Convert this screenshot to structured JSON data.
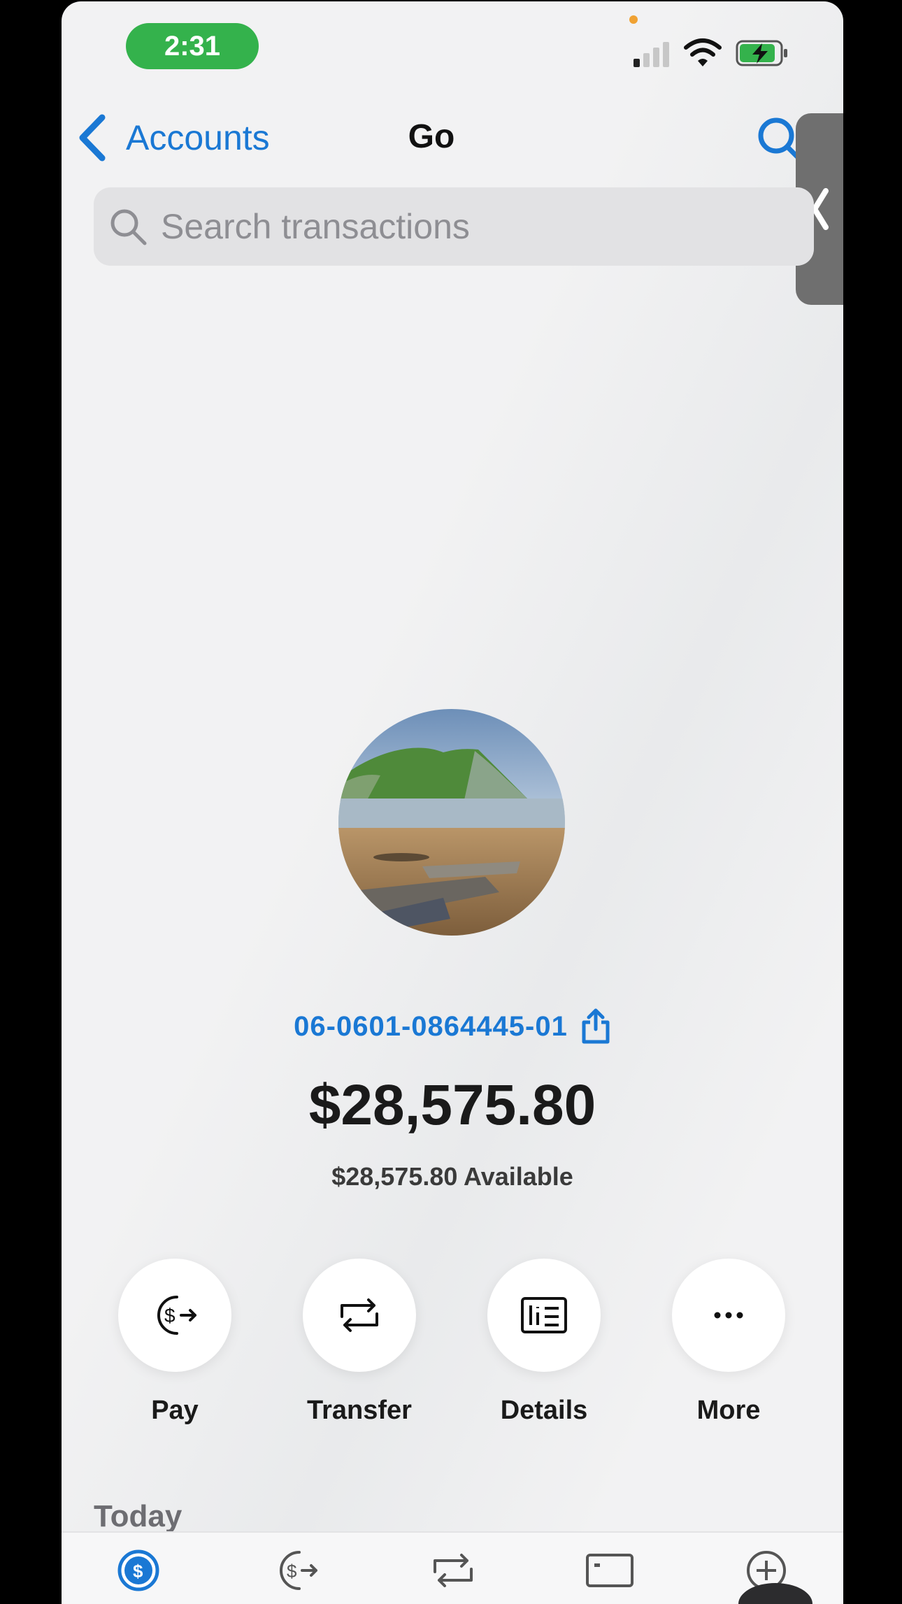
{
  "status_bar": {
    "time": "2:31"
  },
  "nav": {
    "back_label": "Accounts",
    "title": "Go"
  },
  "search": {
    "placeholder": "Search transactions"
  },
  "account": {
    "number": "06-0601-0864445-01",
    "balance": "$28,575.80",
    "available": "$28,575.80 Available"
  },
  "actions": [
    {
      "label": "Pay",
      "icon": "pay-icon"
    },
    {
      "label": "Transfer",
      "icon": "transfer-icon"
    },
    {
      "label": "Details",
      "icon": "details-icon"
    },
    {
      "label": "More",
      "icon": "more-icon"
    }
  ],
  "section": {
    "today": "Today"
  },
  "tabbar": {
    "tabs": [
      {
        "icon": "accounts-tab-icon",
        "selected": true
      },
      {
        "icon": "pay-tab-icon",
        "selected": false
      },
      {
        "icon": "transfer-tab-icon",
        "selected": false
      },
      {
        "icon": "cards-tab-icon",
        "selected": false
      },
      {
        "icon": "more-tab-icon",
        "selected": false
      }
    ]
  },
  "colors": {
    "accent": "#1a78d4",
    "time_pill": "#34b24c",
    "battery": "#34b24c"
  }
}
